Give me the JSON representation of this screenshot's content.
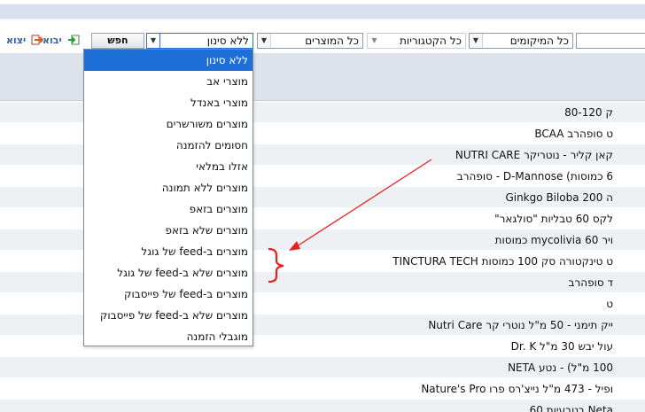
{
  "toolbar": {
    "search_value": "",
    "filter_location": "כל המיקומים",
    "filter_category": "כל הקטגוריות",
    "filter_products": "כל המוצרים",
    "filter_status": "ללא סינון",
    "search_button": "חפש",
    "import_label": "יבוא",
    "export_label": "יצוא"
  },
  "dropdown": {
    "selected": "ללא סינון",
    "options": [
      "ללא סינון",
      "מוצרי אב",
      "מוצרי באנדל",
      "מוצרים משורשרים",
      "חסומים להזמנה",
      "אזלו במלאי",
      "מוצרים ללא תמונה",
      "מוצרים בזאפ",
      "מוצרים שלא בזאפ",
      "מוצרים ב-feed של גוגל",
      "מוצרים שלא ב-feed של גוגל",
      "מוצרים ב-feed של פייסבוק",
      "מוצרים שלא ב-feed של פייסבוק",
      "מוגבלי הזמנה"
    ]
  },
  "products": [
    "ק 80-120",
    "ט סופהרב BCAA",
    "קאן קליר - נוטריקר NUTRI CARE",
    "6 כמוסות) D-Mannose - סופהרב",
    "ה Ginkgo Biloba 200",
    "לקס 60 טבליות \"סולגאר\"",
    "ויר mycolivia 60 כמוסות",
    "ט טינקטורה סק 100 כמוסות TINCTURA TECH",
    "ד סופהרב",
    "ט",
    "ייק תימני - 50 מ\"ל נוטרי קר Nutri Care",
    "עול יבש 30 מ\"ל Dr. K",
    "100 מ\"ל) - נטע NETA",
    "ופיל - 473 מ\"ל נייצ'רס פרו Nature's Pro",
    "Neta בטבעיות 60"
  ],
  "annotation": {
    "color": "#e8201f"
  }
}
